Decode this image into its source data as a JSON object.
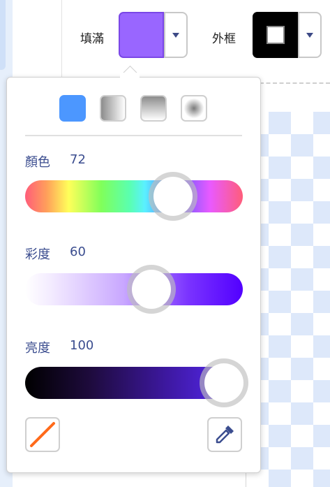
{
  "toolbar": {
    "fill_label": "填滿",
    "outline_label": "外框",
    "fill_color": "#9966FF",
    "outline_color": "#000000"
  },
  "color_picker": {
    "gradient_types": [
      "solid-icon",
      "horizontal-gradient-icon",
      "vertical-gradient-icon",
      "radial-gradient-icon"
    ],
    "selected_gradient": "solid-icon",
    "hue": {
      "label": "顏色",
      "value": "72",
      "level": 0.72
    },
    "saturation": {
      "label": "彩度",
      "value": "60",
      "level": 0.6
    },
    "brightness": {
      "label": "亮度",
      "value": "100",
      "level": 1.0
    },
    "accent_color": "#855CD6"
  }
}
